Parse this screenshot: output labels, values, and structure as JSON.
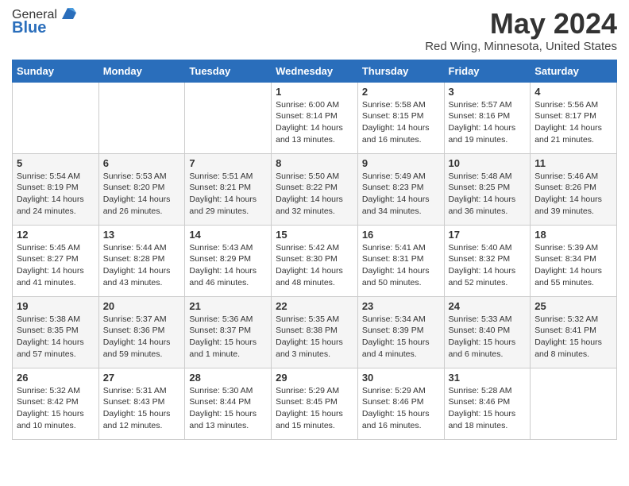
{
  "header": {
    "logo": {
      "line1": "General",
      "line2": "Blue"
    },
    "title": "May 2024",
    "location": "Red Wing, Minnesota, United States"
  },
  "weekdays": [
    "Sunday",
    "Monday",
    "Tuesday",
    "Wednesday",
    "Thursday",
    "Friday",
    "Saturday"
  ],
  "weeks": [
    [
      {
        "day": "",
        "info": ""
      },
      {
        "day": "",
        "info": ""
      },
      {
        "day": "",
        "info": ""
      },
      {
        "day": "1",
        "info": "Sunrise: 6:00 AM\nSunset: 8:14 PM\nDaylight: 14 hours\nand 13 minutes."
      },
      {
        "day": "2",
        "info": "Sunrise: 5:58 AM\nSunset: 8:15 PM\nDaylight: 14 hours\nand 16 minutes."
      },
      {
        "day": "3",
        "info": "Sunrise: 5:57 AM\nSunset: 8:16 PM\nDaylight: 14 hours\nand 19 minutes."
      },
      {
        "day": "4",
        "info": "Sunrise: 5:56 AM\nSunset: 8:17 PM\nDaylight: 14 hours\nand 21 minutes."
      }
    ],
    [
      {
        "day": "5",
        "info": "Sunrise: 5:54 AM\nSunset: 8:19 PM\nDaylight: 14 hours\nand 24 minutes."
      },
      {
        "day": "6",
        "info": "Sunrise: 5:53 AM\nSunset: 8:20 PM\nDaylight: 14 hours\nand 26 minutes."
      },
      {
        "day": "7",
        "info": "Sunrise: 5:51 AM\nSunset: 8:21 PM\nDaylight: 14 hours\nand 29 minutes."
      },
      {
        "day": "8",
        "info": "Sunrise: 5:50 AM\nSunset: 8:22 PM\nDaylight: 14 hours\nand 32 minutes."
      },
      {
        "day": "9",
        "info": "Sunrise: 5:49 AM\nSunset: 8:23 PM\nDaylight: 14 hours\nand 34 minutes."
      },
      {
        "day": "10",
        "info": "Sunrise: 5:48 AM\nSunset: 8:25 PM\nDaylight: 14 hours\nand 36 minutes."
      },
      {
        "day": "11",
        "info": "Sunrise: 5:46 AM\nSunset: 8:26 PM\nDaylight: 14 hours\nand 39 minutes."
      }
    ],
    [
      {
        "day": "12",
        "info": "Sunrise: 5:45 AM\nSunset: 8:27 PM\nDaylight: 14 hours\nand 41 minutes."
      },
      {
        "day": "13",
        "info": "Sunrise: 5:44 AM\nSunset: 8:28 PM\nDaylight: 14 hours\nand 43 minutes."
      },
      {
        "day": "14",
        "info": "Sunrise: 5:43 AM\nSunset: 8:29 PM\nDaylight: 14 hours\nand 46 minutes."
      },
      {
        "day": "15",
        "info": "Sunrise: 5:42 AM\nSunset: 8:30 PM\nDaylight: 14 hours\nand 48 minutes."
      },
      {
        "day": "16",
        "info": "Sunrise: 5:41 AM\nSunset: 8:31 PM\nDaylight: 14 hours\nand 50 minutes."
      },
      {
        "day": "17",
        "info": "Sunrise: 5:40 AM\nSunset: 8:32 PM\nDaylight: 14 hours\nand 52 minutes."
      },
      {
        "day": "18",
        "info": "Sunrise: 5:39 AM\nSunset: 8:34 PM\nDaylight: 14 hours\nand 55 minutes."
      }
    ],
    [
      {
        "day": "19",
        "info": "Sunrise: 5:38 AM\nSunset: 8:35 PM\nDaylight: 14 hours\nand 57 minutes."
      },
      {
        "day": "20",
        "info": "Sunrise: 5:37 AM\nSunset: 8:36 PM\nDaylight: 14 hours\nand 59 minutes."
      },
      {
        "day": "21",
        "info": "Sunrise: 5:36 AM\nSunset: 8:37 PM\nDaylight: 15 hours\nand 1 minute."
      },
      {
        "day": "22",
        "info": "Sunrise: 5:35 AM\nSunset: 8:38 PM\nDaylight: 15 hours\nand 3 minutes."
      },
      {
        "day": "23",
        "info": "Sunrise: 5:34 AM\nSunset: 8:39 PM\nDaylight: 15 hours\nand 4 minutes."
      },
      {
        "day": "24",
        "info": "Sunrise: 5:33 AM\nSunset: 8:40 PM\nDaylight: 15 hours\nand 6 minutes."
      },
      {
        "day": "25",
        "info": "Sunrise: 5:32 AM\nSunset: 8:41 PM\nDaylight: 15 hours\nand 8 minutes."
      }
    ],
    [
      {
        "day": "26",
        "info": "Sunrise: 5:32 AM\nSunset: 8:42 PM\nDaylight: 15 hours\nand 10 minutes."
      },
      {
        "day": "27",
        "info": "Sunrise: 5:31 AM\nSunset: 8:43 PM\nDaylight: 15 hours\nand 12 minutes."
      },
      {
        "day": "28",
        "info": "Sunrise: 5:30 AM\nSunset: 8:44 PM\nDaylight: 15 hours\nand 13 minutes."
      },
      {
        "day": "29",
        "info": "Sunrise: 5:29 AM\nSunset: 8:45 PM\nDaylight: 15 hours\nand 15 minutes."
      },
      {
        "day": "30",
        "info": "Sunrise: 5:29 AM\nSunset: 8:46 PM\nDaylight: 15 hours\nand 16 minutes."
      },
      {
        "day": "31",
        "info": "Sunrise: 5:28 AM\nSunset: 8:46 PM\nDaylight: 15 hours\nand 18 minutes."
      },
      {
        "day": "",
        "info": ""
      }
    ]
  ]
}
